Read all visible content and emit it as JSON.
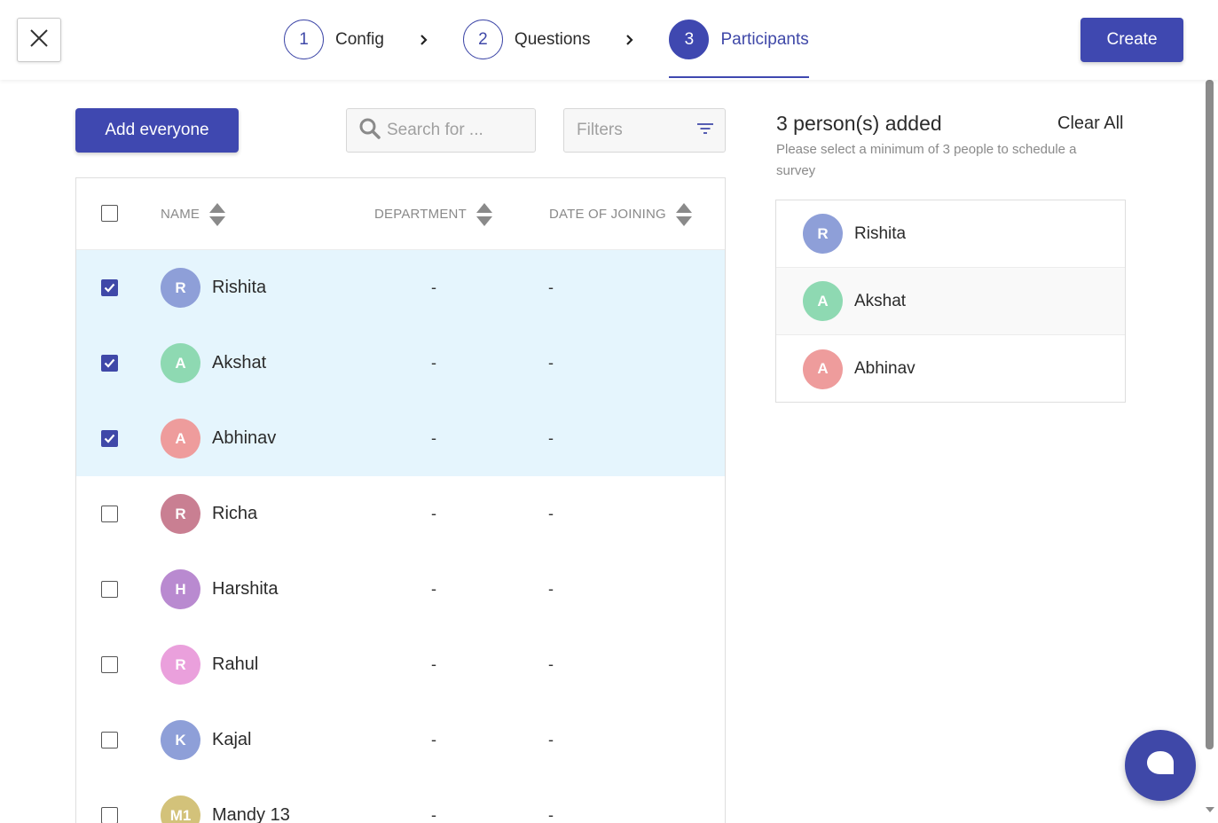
{
  "header": {
    "steps": [
      {
        "number": "1",
        "label": "Config"
      },
      {
        "number": "2",
        "label": "Questions"
      },
      {
        "number": "3",
        "label": "Participants"
      }
    ],
    "active_step": 3,
    "create_label": "Create"
  },
  "toolbar": {
    "add_everyone_label": "Add everyone",
    "search_placeholder": "Search for ...",
    "filters_label": "Filters"
  },
  "table": {
    "columns": [
      "NAME",
      "DEPARTMENT",
      "DATE OF JOINING"
    ],
    "rows": [
      {
        "initial": "R",
        "name": "Rishita",
        "department": "-",
        "date": "-",
        "checked": true,
        "color": "#8e9fd8"
      },
      {
        "initial": "A",
        "name": "Akshat",
        "department": "-",
        "date": "-",
        "checked": true,
        "color": "#8ed9b2"
      },
      {
        "initial": "A",
        "name": "Abhinav",
        "department": "-",
        "date": "-",
        "checked": true,
        "color": "#ee9c9c"
      },
      {
        "initial": "R",
        "name": "Richa",
        "department": "-",
        "date": "-",
        "checked": false,
        "color": "#c97f92"
      },
      {
        "initial": "H",
        "name": "Harshita",
        "department": "-",
        "date": "-",
        "checked": false,
        "color": "#b98ad0"
      },
      {
        "initial": "R",
        "name": "Rahul",
        "department": "-",
        "date": "-",
        "checked": false,
        "color": "#eaa0dc"
      },
      {
        "initial": "K",
        "name": "Kajal",
        "department": "-",
        "date": "-",
        "checked": false,
        "color": "#8e9fd8"
      },
      {
        "initial": "M1",
        "name": "Mandy 13",
        "department": "-",
        "date": "-",
        "checked": false,
        "color": "#d3c27a"
      }
    ]
  },
  "summary": {
    "title": "3 person(s) added",
    "clear_all_label": "Clear All",
    "hint": "Please select a minimum of 3 people to schedule a survey",
    "selected": [
      {
        "initial": "R",
        "name": "Rishita",
        "color": "#8e9fd8"
      },
      {
        "initial": "A",
        "name": "Akshat",
        "color": "#8ed9b2"
      },
      {
        "initial": "A",
        "name": "Abhinav",
        "color": "#ee9c9c"
      }
    ]
  },
  "colors": {
    "accent": "#3f48b0",
    "selected_row": "#e5f5fd"
  },
  "icons": {
    "close": "close-icon",
    "chevron": "chevron-right-icon",
    "search": "search-icon",
    "filter": "filter-icon",
    "sort": "sort-icon",
    "chat": "chat-icon"
  }
}
